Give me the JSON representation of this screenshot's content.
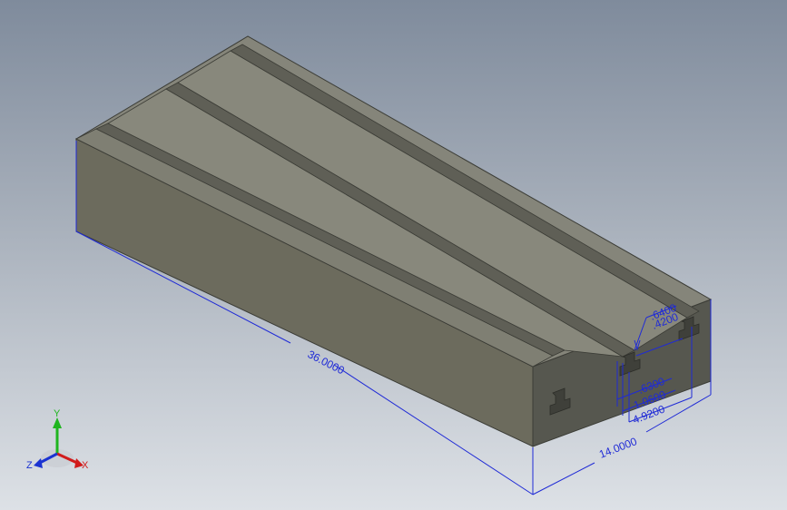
{
  "model": {
    "name": "",
    "face_colors": {
      "top": "#85857a",
      "front_right": "#56574f",
      "left_side": "#6c6b5d",
      "groove": "#4a4a44",
      "edge": "#3b3c36"
    }
  },
  "dimensions": {
    "color": "#1f2ad6",
    "length": "36.0000",
    "width": "14.0000",
    "offset_a": "4.9200",
    "offset_b": "1.0600",
    "slot_width": ".6300",
    "slot_depth_top": ".6400",
    "slot_depth_bottom": ".4200"
  },
  "triad": {
    "x_label": "X",
    "y_label": "Y",
    "z_label": "Z",
    "colors": {
      "x": "#d11b1b",
      "y": "#1fb51f",
      "z": "#1b33d1"
    }
  }
}
